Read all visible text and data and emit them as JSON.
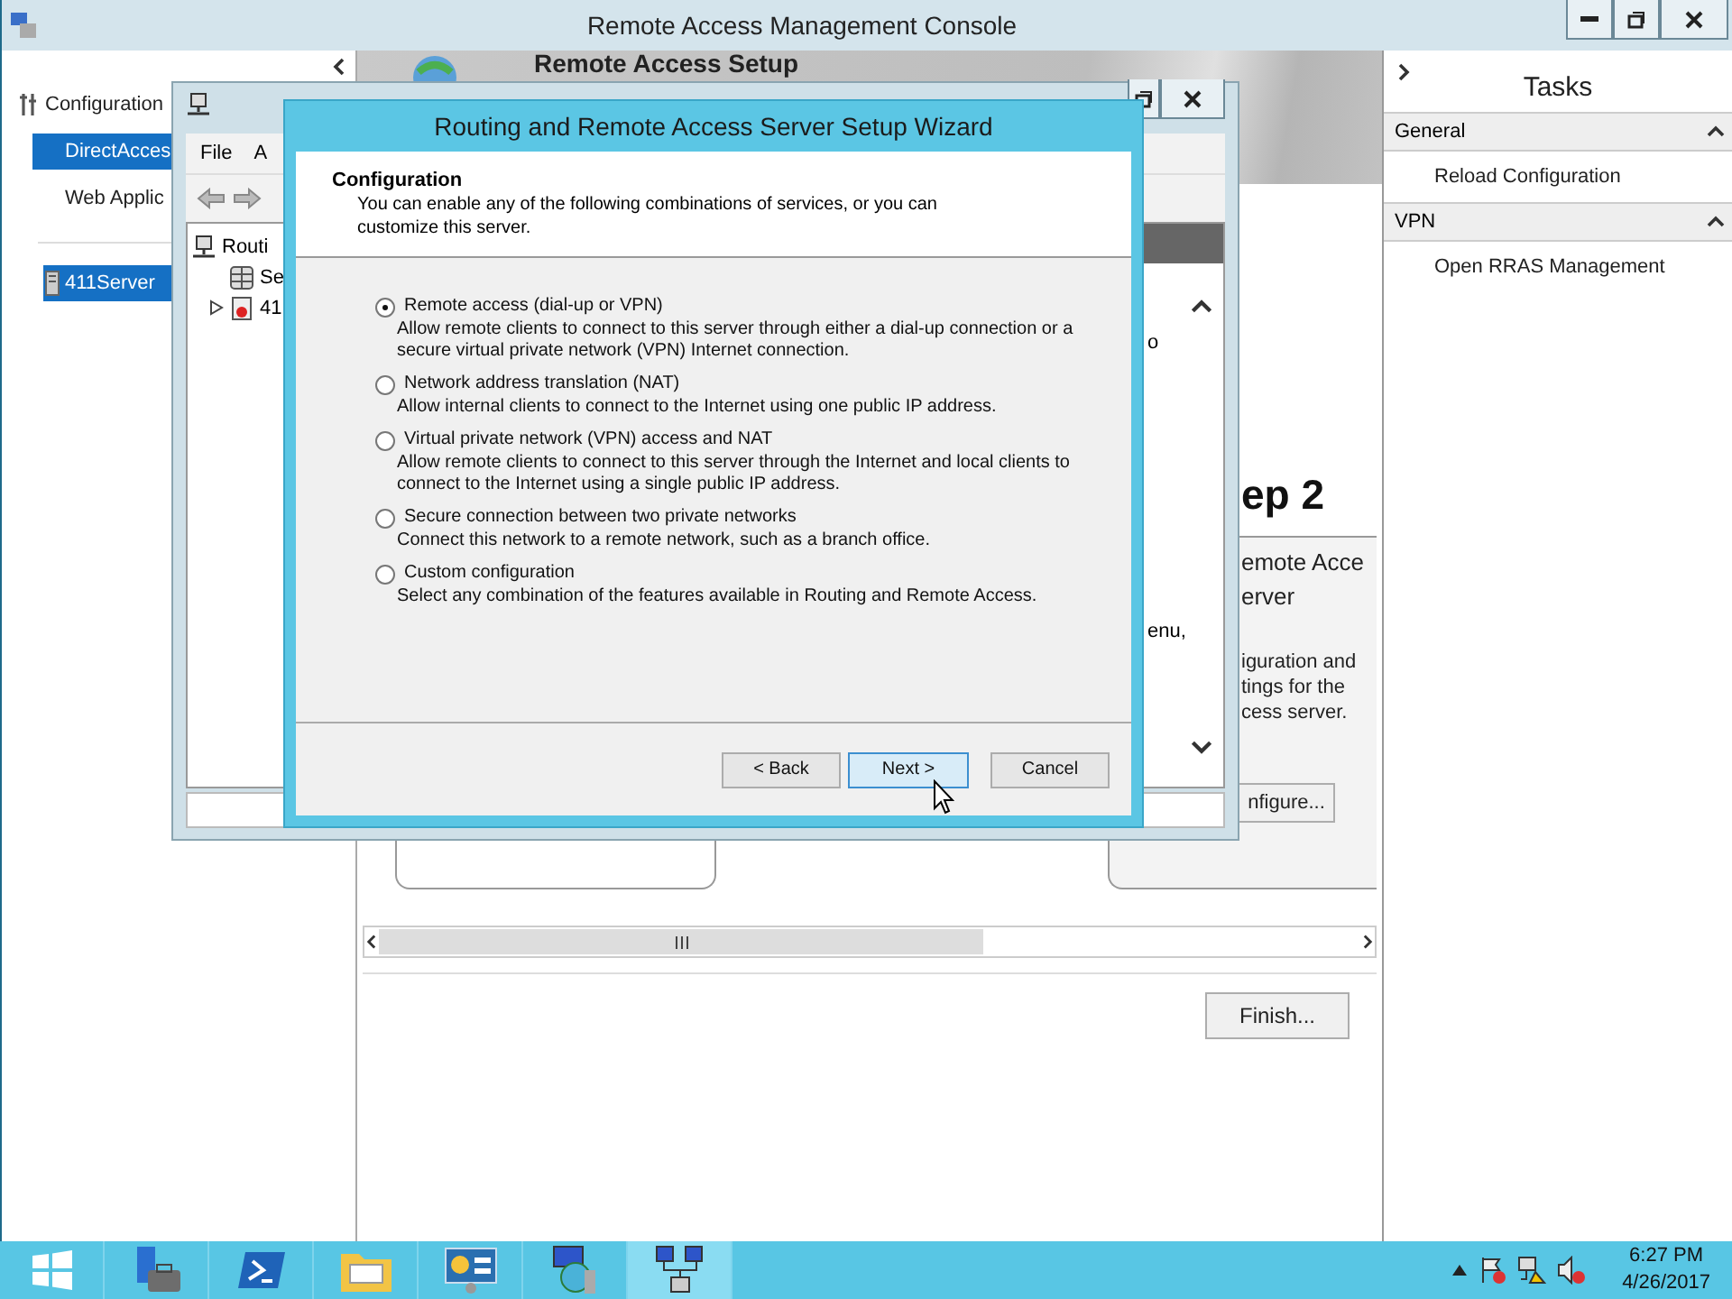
{
  "console": {
    "title": "Remote Access Management Console"
  },
  "nav": [
    {
      "label": "Configuration",
      "kind": "root",
      "selected": false
    },
    {
      "label": "DirectAcces",
      "kind": "page",
      "selected": true
    },
    {
      "label": "Web Applic",
      "kind": "page",
      "selected": false
    },
    {
      "label": "411Server",
      "kind": "server",
      "selected": true
    }
  ],
  "banner": {
    "title": "Remote Access Setup"
  },
  "step": {
    "heading": "ep 2",
    "title_lines": [
      "emote Acce",
      "erver"
    ],
    "description_lines": [
      "iguration and",
      "tings for the",
      "cess server."
    ],
    "button": "nfigure..."
  },
  "finish_button": "Finish...",
  "tasks": {
    "title": "Tasks",
    "groups": [
      {
        "name": "General",
        "expanded": true,
        "items": [
          "Reload Configuration"
        ]
      },
      {
        "name": "VPN",
        "expanded": true,
        "items": [
          "Open RRAS Management"
        ]
      }
    ]
  },
  "rras_window": {
    "menu": [
      "File",
      "A"
    ],
    "tree": [
      {
        "label": "Routi",
        "kind": "root",
        "children": [
          {
            "label": "Se",
            "kind": "servers"
          },
          {
            "label": "41",
            "kind": "server",
            "expanded": false
          }
        ]
      }
    ],
    "content_fragments": [
      "o",
      "enu,"
    ]
  },
  "wizard": {
    "title": "Routing and Remote Access Server Setup Wizard",
    "header_title": "Configuration",
    "header_text": "You can enable any of the following combinations of services, or you can customize this server.",
    "options": [
      {
        "label": "Remote access (dial-up or VPN)",
        "description": "Allow remote clients to connect to this server through either a dial-up connection or a secure virtual private network (VPN) Internet connection.",
        "selected": true
      },
      {
        "label": "Network address translation (NAT)",
        "description": "Allow internal clients to connect to the Internet using one public IP address.",
        "selected": false
      },
      {
        "label": "Virtual private network (VPN) access and NAT",
        "description": "Allow remote clients to connect to this server through the Internet and local clients to connect to the Internet using a single public IP address.",
        "selected": false
      },
      {
        "label": "Secure connection between two private networks",
        "description": "Connect this network to a remote network, such as a branch office.",
        "selected": false
      },
      {
        "label": "Custom configuration",
        "description": "Select any combination of the features available in Routing and Remote Access.",
        "selected": false
      }
    ],
    "buttons": [
      {
        "label": "< Back",
        "kind": "normal"
      },
      {
        "label": "Next >",
        "kind": "default"
      },
      {
        "label": "Cancel",
        "kind": "normal"
      }
    ]
  },
  "taskbar": {
    "apps": [
      {
        "kind": "server-manager",
        "selected": false
      },
      {
        "kind": "powershell",
        "selected": false
      },
      {
        "kind": "explorer",
        "selected": false
      },
      {
        "kind": "control-panel",
        "selected": false
      },
      {
        "kind": "remote-access",
        "selected": false
      },
      {
        "kind": "routing",
        "selected": true
      }
    ],
    "time": "6:27 PM",
    "date": "4/26/2017"
  }
}
